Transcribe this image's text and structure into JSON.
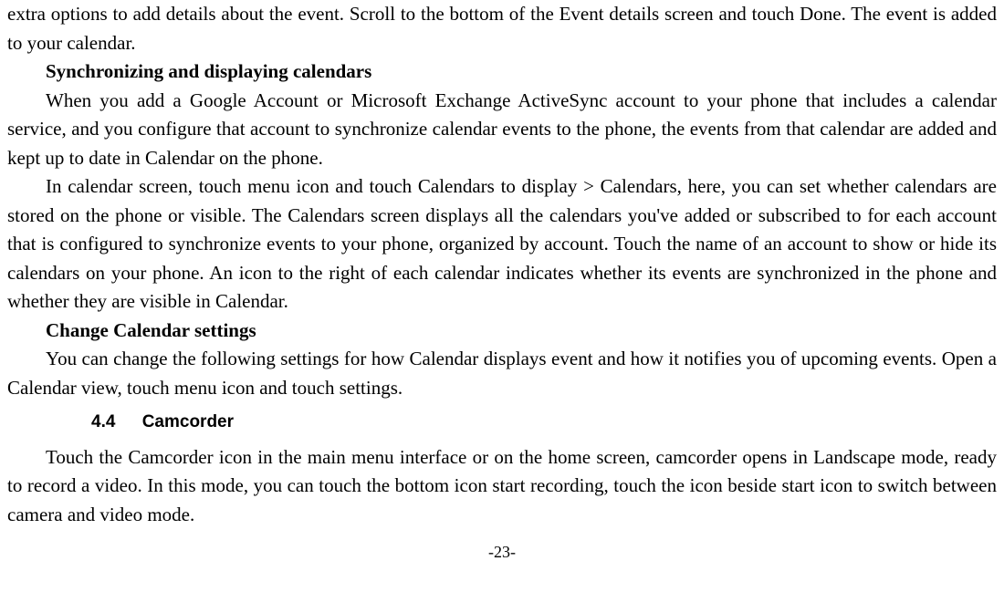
{
  "content": {
    "p1": "extra options to add details about the event. Scroll to the bottom of the Event details screen and touch Done. The event is added to your calendar.",
    "h1": "Synchronizing and displaying calendars",
    "p2": "When you add a Google Account or Microsoft Exchange ActiveSync account to your phone that includes a calendar service, and you configure that account to synchronize calendar events to the phone, the events from that calendar are added and kept up to date in Calendar on the phone.",
    "p3": "In calendar screen, touch menu icon and touch Calendars to display > Calendars, here, you can set whether calendars are stored on the phone or visible. The Calendars screen displays all the calendars you've added or subscribed to for each account that is configured to synchronize events to your phone, organized by account. Touch the name of an account to show or hide its calendars on your phone. An icon to the right of each calendar indicates whether its events are synchronized in the phone and whether they are visible in Calendar.",
    "h2": "Change Calendar settings",
    "p4": "You can change the following settings for how Calendar displays event and how it notifies you of upcoming events. Open a Calendar view, touch menu icon and touch settings.",
    "section_num": "4.4",
    "section_title": "Camcorder",
    "p5": "Touch the Camcorder icon in the main menu interface or on the home screen, camcorder opens in Landscape mode, ready to record a video. In this mode, you can touch the bottom icon start recording, touch the icon beside start icon to switch between camera and video mode.",
    "page_number": "-23-"
  }
}
